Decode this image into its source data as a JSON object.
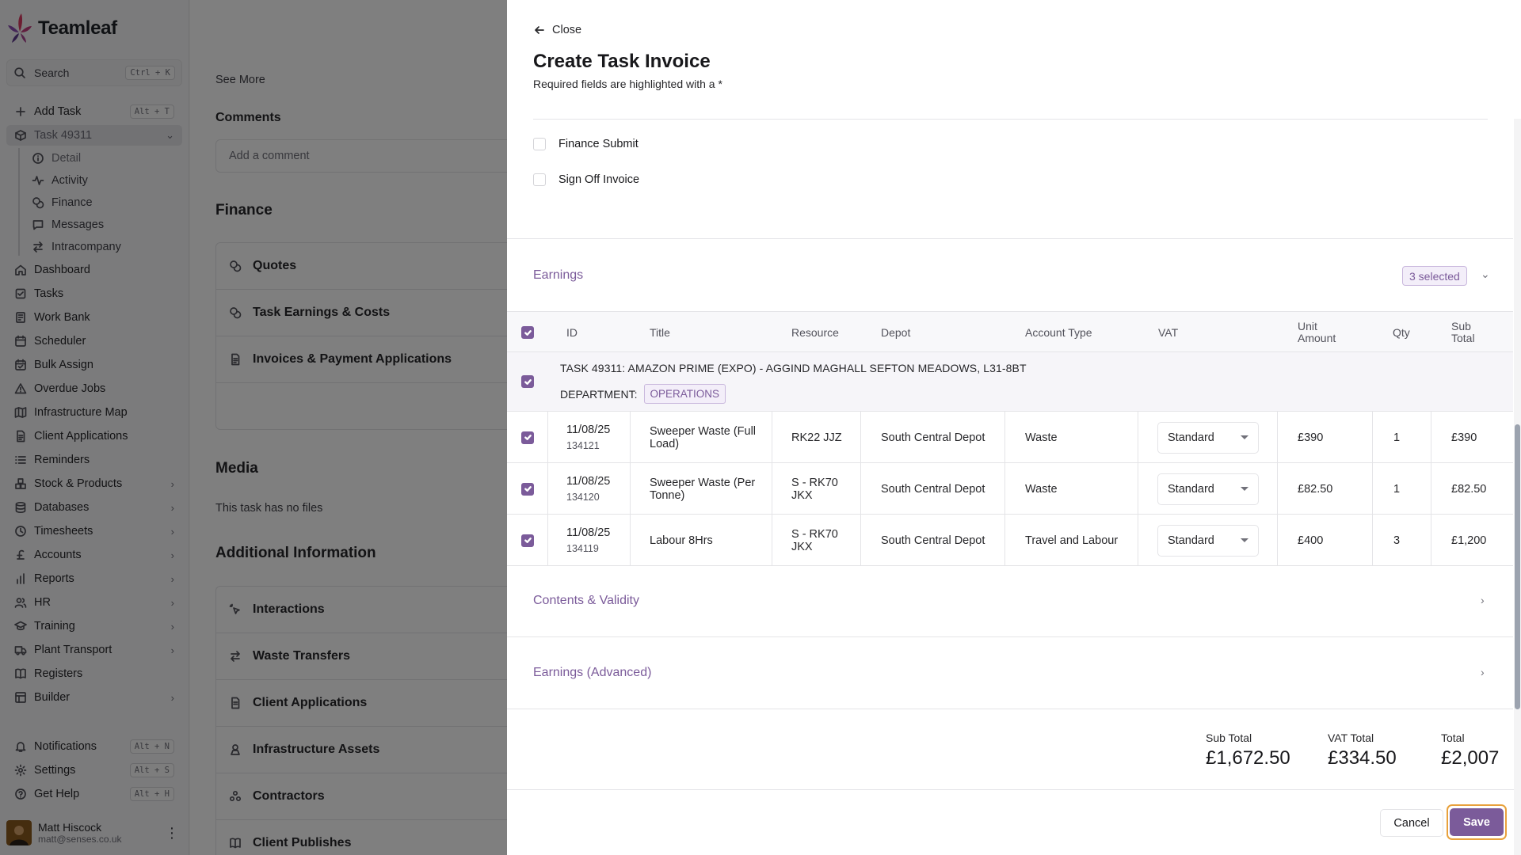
{
  "app": {
    "name": "Teamleaf",
    "search": {
      "label": "Search",
      "shortcut": "Ctrl + K"
    },
    "nav_top": [
      {
        "label": "Add Task",
        "icon": "plus-icon",
        "shortcut": "Alt + T"
      },
      {
        "label": "Task 49311",
        "icon": "box-icon",
        "expanded": true
      }
    ],
    "task_sub": [
      {
        "label": "Detail",
        "icon": "info-icon"
      },
      {
        "label": "Activity",
        "icon": "activity-icon"
      },
      {
        "label": "Finance",
        "icon": "coins-icon"
      },
      {
        "label": "Messages",
        "icon": "message-icon"
      },
      {
        "label": "Intracompany",
        "icon": "swap-icon"
      }
    ],
    "nav": [
      {
        "label": "Dashboard",
        "icon": "home-icon",
        "chevron": false
      },
      {
        "label": "Tasks",
        "icon": "checklist-icon",
        "chevron": false
      },
      {
        "label": "Work Bank",
        "icon": "bank-icon",
        "chevron": false
      },
      {
        "label": "Scheduler",
        "icon": "calendar-icon",
        "chevron": false
      },
      {
        "label": "Bulk Assign",
        "icon": "calendar-check-icon",
        "chevron": false
      },
      {
        "label": "Overdue Jobs",
        "icon": "warning-icon",
        "chevron": false
      },
      {
        "label": "Infrastructure Map",
        "icon": "map-icon",
        "chevron": false
      },
      {
        "label": "Client Applications",
        "icon": "document-icon",
        "chevron": false
      },
      {
        "label": "Reminders",
        "icon": "list-icon",
        "chevron": false
      },
      {
        "label": "Stock & Products",
        "icon": "boxes-icon",
        "chevron": true
      },
      {
        "label": "Databases",
        "icon": "database-icon",
        "chevron": true
      },
      {
        "label": "Timesheets",
        "icon": "clock-icon",
        "chevron": true
      },
      {
        "label": "Accounts",
        "icon": "pound-icon",
        "chevron": true
      },
      {
        "label": "Reports",
        "icon": "bar-chart-icon",
        "chevron": true
      },
      {
        "label": "HR",
        "icon": "users-icon",
        "chevron": true
      },
      {
        "label": "Training",
        "icon": "graduation-icon",
        "chevron": true
      },
      {
        "label": "Plant Transport",
        "icon": "truck-icon",
        "chevron": true
      },
      {
        "label": "Registers",
        "icon": "book-icon",
        "chevron": false
      },
      {
        "label": "Builder",
        "icon": "grid-icon",
        "chevron": true
      }
    ],
    "nav_bottom": [
      {
        "label": "Notifications",
        "icon": "bell-icon",
        "shortcut": "Alt + N"
      },
      {
        "label": "Settings",
        "icon": "gear-icon",
        "shortcut": "Alt + S"
      },
      {
        "label": "Get Help",
        "icon": "help-icon",
        "shortcut": "Alt + H"
      }
    ],
    "user": {
      "name": "Matt Hiscock",
      "email": "matt@senses.co.uk"
    }
  },
  "background": {
    "see_more": "See More",
    "comments_title": "Comments",
    "comment_placeholder": "Add a comment",
    "finance_title": "Finance",
    "finance_items": [
      {
        "label": "Quotes",
        "icon": "coins-icon"
      },
      {
        "label": "Task Earnings & Costs",
        "icon": "coins-icon"
      },
      {
        "label": "Invoices & Payment Applications",
        "icon": "document-icon"
      }
    ],
    "media_title": "Media",
    "media_empty": "This task has no files",
    "additional_title": "Additional Information",
    "additional_items": [
      {
        "label": "Interactions",
        "icon": "pointer-icon"
      },
      {
        "label": "Waste Transfers",
        "icon": "swap-icon"
      },
      {
        "label": "Client Applications",
        "icon": "document-icon"
      },
      {
        "label": "Infrastructure Assets",
        "icon": "asset-icon"
      },
      {
        "label": "Contractors",
        "icon": "contractors-icon"
      },
      {
        "label": "Client Publishes",
        "icon": "book-icon"
      }
    ]
  },
  "drawer": {
    "close_label": "Close",
    "title": "Create Task Invoice",
    "subtitle": "Required fields are highlighted with a *",
    "checkboxes": [
      {
        "label": "Finance Submit",
        "checked": false
      },
      {
        "label": "Sign Off Invoice",
        "checked": false
      }
    ],
    "earnings": {
      "title": "Earnings",
      "selected": "3 selected",
      "columns": [
        "ID",
        "Title",
        "Resource",
        "Depot",
        "Account Type",
        "VAT",
        "Unit Amount",
        "Qty",
        "Sub Total"
      ],
      "group": {
        "title": "TASK 49311: AMAZON PRIME (EXPO) - AGGIND MAGHALL SEFTON MEADOWS, L31-8BT",
        "department_label": "DEPARTMENT:",
        "department": "OPERATIONS"
      },
      "rows": [
        {
          "date": "11/08/25",
          "id": "134121",
          "title": "Sweeper Waste (Full Load)",
          "resource": "RK22 JJZ",
          "depot": "South Central Depot",
          "account_type": "Waste",
          "vat": "Standard",
          "unit_amount": "£390",
          "qty": "1",
          "sub_total": "£390"
        },
        {
          "date": "11/08/25",
          "id": "134120",
          "title": "Sweeper Waste (Per Tonne)",
          "resource": "S - RK70 JKX",
          "depot": "South Central Depot",
          "account_type": "Waste",
          "vat": "Standard",
          "unit_amount": "£82.50",
          "qty": "1",
          "sub_total": "£82.50"
        },
        {
          "date": "11/08/25",
          "id": "134119",
          "title": "Labour 8Hrs",
          "resource": "S - RK70 JKX",
          "depot": "South Central Depot",
          "account_type": "Travel and Labour",
          "vat": "Standard",
          "unit_amount": "£400",
          "qty": "3",
          "sub_total": "£1,200"
        }
      ]
    },
    "contents_validity": "Contents & Validity",
    "earnings_advanced": "Earnings (Advanced)",
    "totals": {
      "sub_total_label": "Sub Total",
      "sub_total": "£1,672.50",
      "vat_total_label": "VAT Total",
      "vat_total": "£334.50",
      "total_label": "Total",
      "total": "£2,007"
    },
    "cancel_label": "Cancel",
    "save_label": "Save"
  },
  "colors": {
    "accent": "#7b5b9a",
    "focus_ring": "#e8a13c",
    "overlay": "rgba(0,0,0,0.5)"
  }
}
